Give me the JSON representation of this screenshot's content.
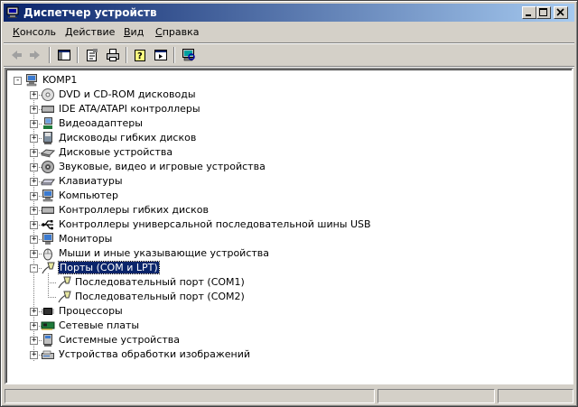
{
  "window": {
    "title": "Диспетчер устройств"
  },
  "menu": [
    {
      "label": "Консоль",
      "accel": "К"
    },
    {
      "label": "Действие",
      "accel": "Д"
    },
    {
      "label": "Вид",
      "accel": "В"
    },
    {
      "label": "Справка",
      "accel": "С"
    }
  ],
  "toolbar": {
    "buttons": [
      "back-icon",
      "forward-icon",
      "show-hide-tree-icon",
      "properties-icon",
      "print-icon",
      "help-icon",
      "console-view-icon",
      "scan-hardware-icon"
    ]
  },
  "tree": {
    "root": "KOMP1",
    "items": [
      {
        "label": "DVD и CD-ROM дисководы",
        "icon": "cdrom-icon"
      },
      {
        "label": "IDE ATA/ATAPI контроллеры",
        "icon": "ide-controller-icon"
      },
      {
        "label": "Видеоадаптеры",
        "icon": "display-adapter-icon"
      },
      {
        "label": "Дисководы гибких дисков",
        "icon": "floppy-drive-icon"
      },
      {
        "label": "Дисковые устройства",
        "icon": "disk-drive-icon"
      },
      {
        "label": "Звуковые, видео и игровые устройства",
        "icon": "sound-icon"
      },
      {
        "label": "Клавиатуры",
        "icon": "keyboard-icon"
      },
      {
        "label": "Компьютер",
        "icon": "computer-icon"
      },
      {
        "label": "Контроллеры гибких дисков",
        "icon": "floppy-controller-icon"
      },
      {
        "label": "Контроллеры универсальной последовательной шины USB",
        "icon": "usb-icon"
      },
      {
        "label": "Мониторы",
        "icon": "monitor-icon"
      },
      {
        "label": "Мыши и иные указывающие устройства",
        "icon": "mouse-icon"
      },
      {
        "label": "Порты (COM и LPT)",
        "icon": "port-icon"
      },
      {
        "label": "Последовательный порт (COM1)",
        "icon": "port-icon"
      },
      {
        "label": "Последовательный порт (COM2)",
        "icon": "port-icon"
      },
      {
        "label": "Процессоры",
        "icon": "processor-icon"
      },
      {
        "label": "Сетевые платы",
        "icon": "network-adapter-icon"
      },
      {
        "label": "Системные устройства",
        "icon": "system-device-icon"
      },
      {
        "label": "Устройства обработки изображений",
        "icon": "imaging-device-icon"
      }
    ]
  },
  "status": {
    "panes": [
      "",
      "",
      ""
    ]
  },
  "colors": {
    "titlebar_start": "#0a246a",
    "titlebar_end": "#a6caf0",
    "face": "#d4d0c8",
    "selection": "#0a246a"
  }
}
